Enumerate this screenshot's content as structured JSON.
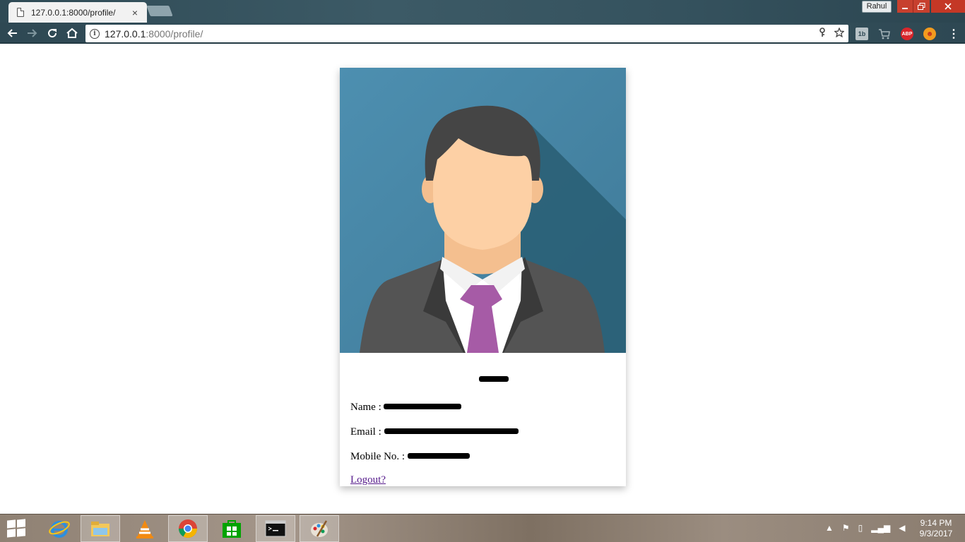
{
  "browser": {
    "tab_title": "127.0.0.1:8000/profile/",
    "tab_close": "×",
    "profile_label": "Rahul",
    "url_host": "127.0.0.1",
    "url_path": ":8000/profile/",
    "ext_1_label": "1b",
    "ext_3_label": "ABP",
    "icons": [
      "file-icon",
      "back-icon",
      "forward-icon",
      "reload-icon",
      "home-icon",
      "info-icon",
      "key-icon",
      "star-icon",
      "cart-icon",
      "menu-icon"
    ]
  },
  "profile": {
    "name_label": "Name : ",
    "email_label": "Email : ",
    "mobile_label": "Mobile No. : ",
    "logout_label": "Logout?"
  },
  "taskbar": {
    "time": "9:14 PM",
    "date": "9/3/2017",
    "apps": [
      "internet-explorer",
      "file-explorer",
      "vlc",
      "chrome",
      "store",
      "command-prompt",
      "paint"
    ]
  },
  "colors": {
    "avatar_bg": "#4c8aaa",
    "avatar_shadow": "#2a5f75",
    "hair": "#454545",
    "skin": "#fdd0a5",
    "suit": "#545454",
    "tie": "#a65ba6",
    "link": "#551a8b"
  }
}
